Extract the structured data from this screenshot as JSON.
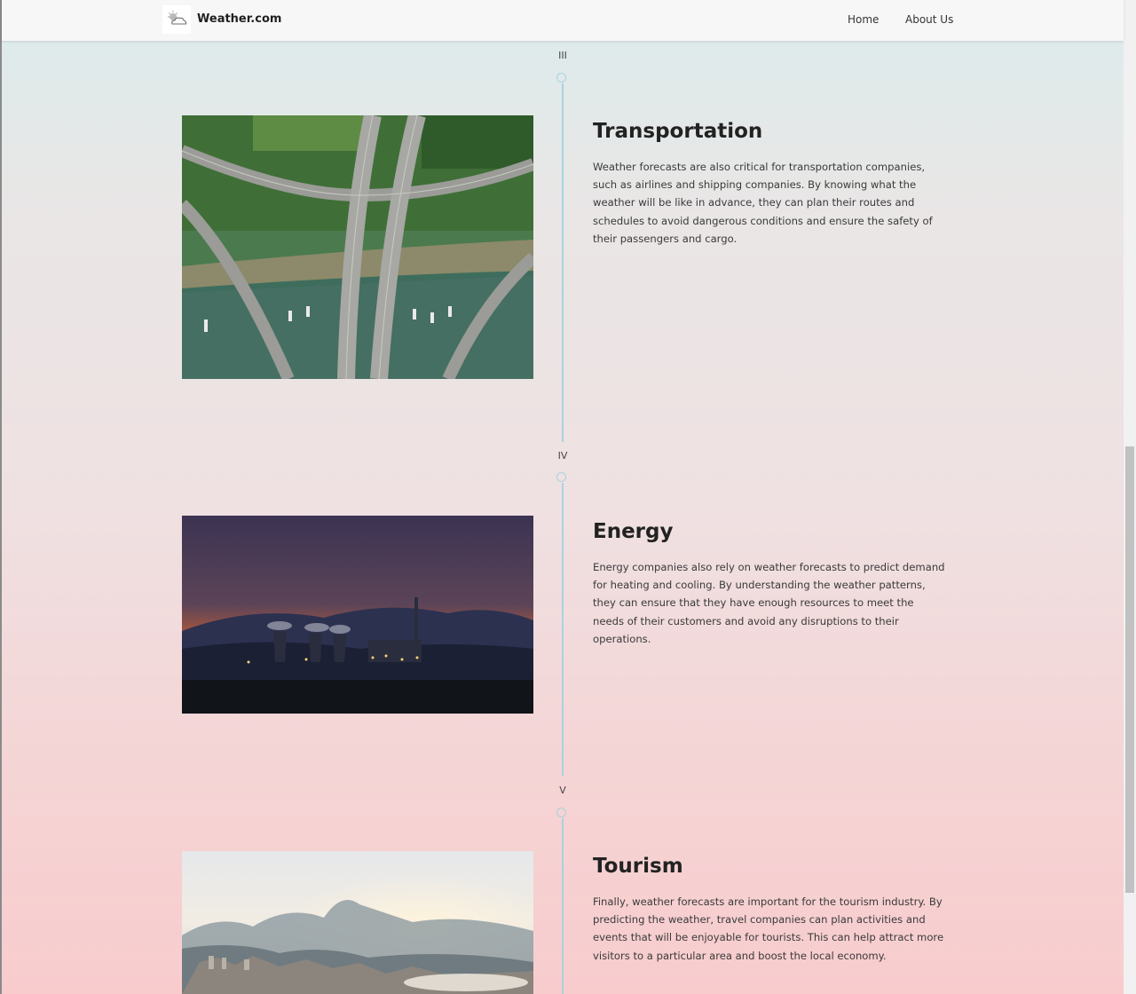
{
  "header": {
    "brand": "Weather.com",
    "nav": [
      {
        "label": "Home"
      },
      {
        "label": "About Us"
      }
    ]
  },
  "sections": [
    {
      "numeral": "III",
      "title": "Transportation",
      "text": "Weather forecasts are also critical for transportation companies, such as airlines and shipping companies. By knowing what the weather will be like in advance, they can plan their routes and schedules to avoid dangerous conditions and ensure the safety of their passengers and cargo."
    },
    {
      "numeral": "IV",
      "title": "Energy",
      "text": "Energy companies also rely on weather forecasts to predict demand for heating and cooling. By understanding the weather patterns, they can ensure that they have enough resources to meet the needs of their customers and avoid any disruptions to their operations."
    },
    {
      "numeral": "V",
      "title": "Tourism",
      "text": "Finally, weather forecasts are important for the tourism industry. By predicting the weather, travel companies can plan activities and events that will be enjoyable for tourists. This can help attract more visitors to a particular area and boost the local economy."
    }
  ],
  "icons": {
    "logo": "weather-logo-icon"
  },
  "colors": {
    "timeline": "#a8d3df",
    "header_bg": "#f7f7f7"
  }
}
